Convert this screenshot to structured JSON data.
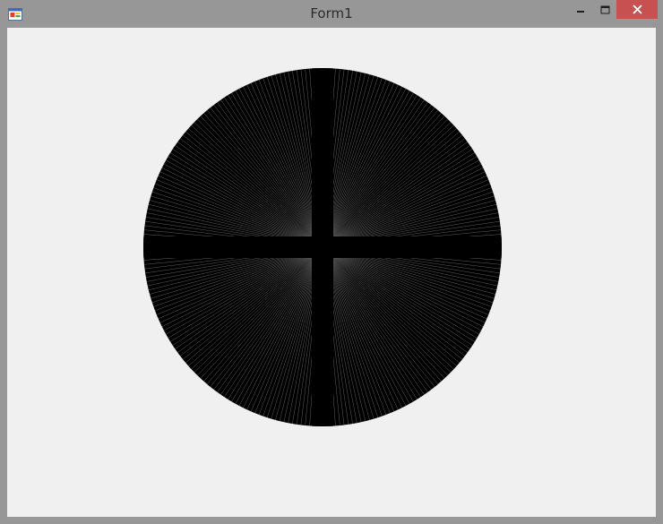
{
  "window": {
    "title": "Form1",
    "icons": {
      "app": "form-app-icon",
      "minimize": "minimize-icon",
      "maximize": "maximize-icon",
      "close": "close-icon"
    },
    "colors": {
      "frame": "#979797",
      "client_background": "#f0f0f0",
      "close_button": "#c75050",
      "drawing": "#000000"
    }
  }
}
